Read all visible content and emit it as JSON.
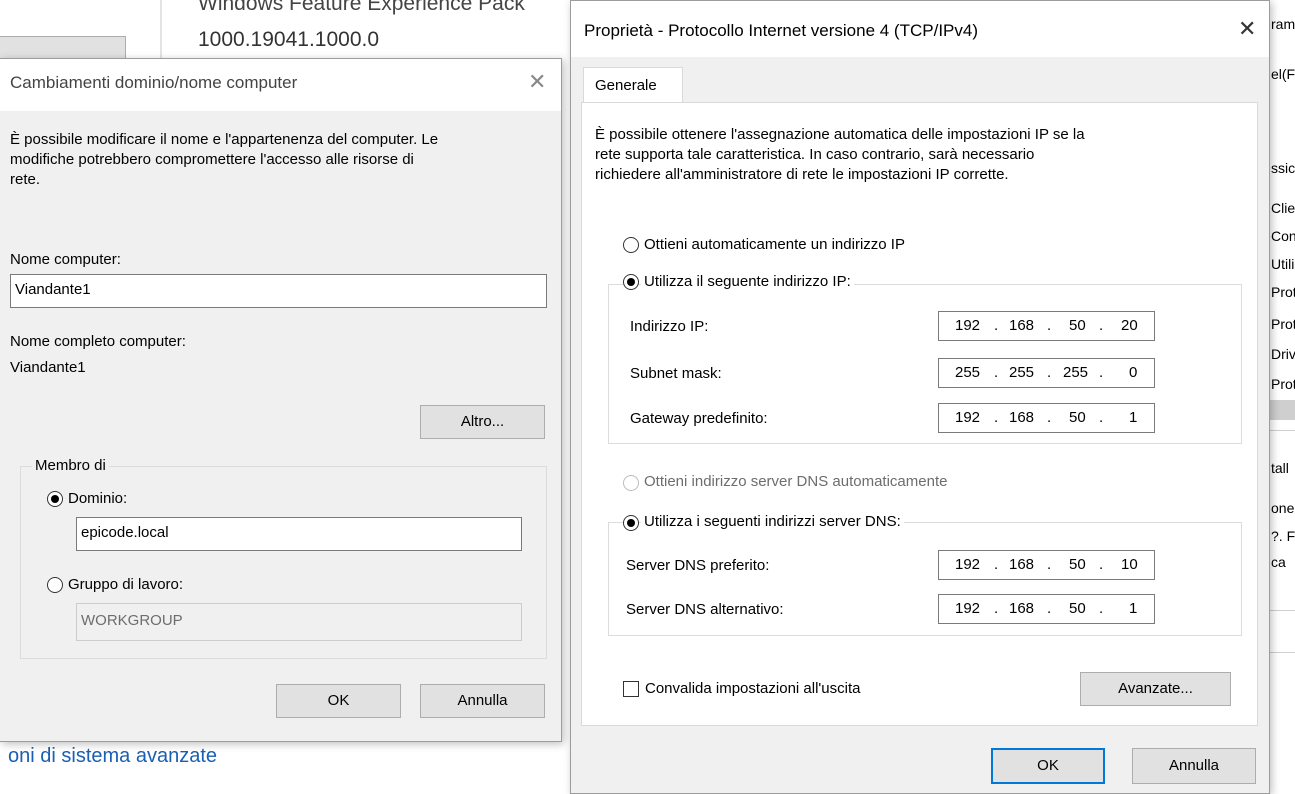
{
  "background": {
    "feature_pack_text": "Windows Feature Experience Pack",
    "feature_pack_version": "1000.19041.1000.0",
    "advanced_link": "oni di sistema avanzate",
    "right_strip_items": [
      "ram",
      "el(F",
      "ssic",
      "Clie",
      "Con",
      "Utili",
      "Prot",
      "Prot",
      "Driv",
      "Prot",
      "tall",
      "one",
      "?. F",
      "ca"
    ]
  },
  "left_dialog": {
    "title": "Cambiamenti dominio/nome computer",
    "description_lines": [
      "È possibile modificare il nome e l'appartenenza del computer. Le",
      "modifiche potrebbero compromettere l'accesso alle risorse di",
      "rete."
    ],
    "computer_name_label": "Nome computer:",
    "computer_name_value": "Viandante1",
    "full_name_label": "Nome completo computer:",
    "full_name_value": "Viandante1",
    "more_button": "Altro...",
    "member_of_legend": "Membro di",
    "domain_label": "Dominio:",
    "domain_value": "epicode.local",
    "workgroup_label": "Gruppo di lavoro:",
    "workgroup_value": "WORKGROUP",
    "ok_button": "OK",
    "cancel_button": "Annulla"
  },
  "right_dialog": {
    "title": "Proprietà - Protocollo Internet versione 4 (TCP/IPv4)",
    "tab_general": "Generale",
    "description_lines": [
      "È possibile ottenere l'assegnazione automatica delle impostazioni IP se la",
      "rete supporta tale caratteristica. In caso contrario, sarà necessario",
      "richiedere all'amministratore di rete le impostazioni IP corrette."
    ],
    "auto_ip_label": "Ottieni automaticamente un indirizzo IP",
    "static_ip_label": "Utilizza il seguente indirizzo IP:",
    "ip_address_label": "Indirizzo IP:",
    "ip_address": [
      "192",
      "168",
      "50",
      "20"
    ],
    "subnet_label": "Subnet mask:",
    "subnet": [
      "255",
      "255",
      "255",
      "0"
    ],
    "gateway_label": "Gateway predefinito:",
    "gateway": [
      "192",
      "168",
      "50",
      "1"
    ],
    "auto_dns_label": "Ottieni indirizzo server DNS automaticamente",
    "static_dns_label": "Utilizza i seguenti indirizzi server DNS:",
    "preferred_dns_label": "Server DNS preferito:",
    "preferred_dns": [
      "192",
      "168",
      "50",
      "10"
    ],
    "alternate_dns_label": "Server DNS alternativo:",
    "alternate_dns": [
      "192",
      "168",
      "50",
      "1"
    ],
    "validate_label": "Convalida impostazioni all'uscita",
    "advanced_button": "Avanzate...",
    "ok_button": "OK",
    "cancel_button": "Annulla"
  }
}
